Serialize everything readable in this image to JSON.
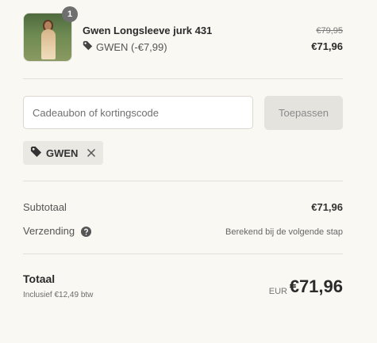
{
  "product": {
    "quantity": "1",
    "name": "Gwen Longsleeve jurk 431",
    "discount_text": "GWEN (-€7,99)",
    "original_price": "€79,95",
    "price": "€71,96"
  },
  "discount": {
    "placeholder": "Cadeaubon of kortingscode",
    "apply_label": "Toepassen",
    "applied_code": "GWEN"
  },
  "summary": {
    "subtotal_label": "Subtotaal",
    "subtotal_value": "€71,96",
    "shipping_label": "Verzending",
    "shipping_value": "Berekend bij de volgende stap"
  },
  "total": {
    "label": "Totaal",
    "tax_note": "Inclusief €12,49 btw",
    "currency": "EUR",
    "amount": "€71,96"
  },
  "icons": {
    "tag": "tag-icon",
    "close": "close-icon",
    "help": "question-circle-icon"
  }
}
